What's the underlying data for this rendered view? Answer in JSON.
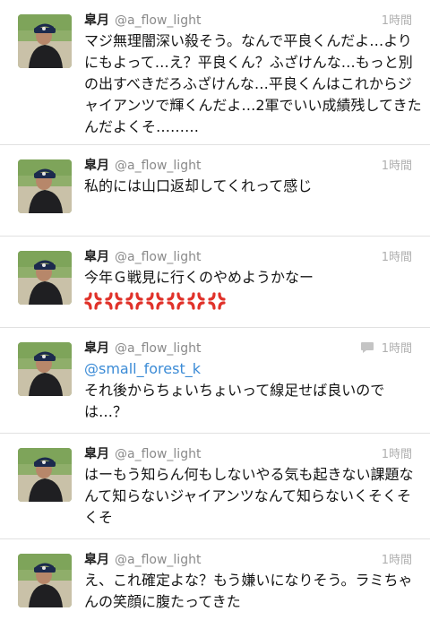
{
  "tweets": [
    {
      "name": "皐月",
      "handle": "@a_flow_light",
      "time": "1時間",
      "text": "マジ無理闇深い殺そう。なんで平良くんだよ…よりにもよって…え？平良くん？ふざけんな…もっと別の出すべきだろふざけんな…平良くんはこれからジャイアンツで輝くんだよ…2軍でいい成績残してきたんだよくそ………"
    },
    {
      "name": "皐月",
      "handle": "@a_flow_light",
      "time": "1時間",
      "text": "私的には山口返却してくれって感じ"
    },
    {
      "name": "皐月",
      "handle": "@a_flow_light",
      "time": "1時間",
      "text": "今年Ｇ戦見に行くのやめようかなー",
      "emoji_count": 7,
      "emoji_name": "anger-symbol-icon"
    },
    {
      "name": "皐月",
      "handle": "@a_flow_light",
      "time": "1時間",
      "has_reply": true,
      "mention": "@small_forest_k",
      "text": "それ後からちょいちょいって線足せば良いのでは…？"
    },
    {
      "name": "皐月",
      "handle": "@a_flow_light",
      "time": "1時間",
      "text": "はーもう知らん何もしないやる気も起きない課題なんて知らないジャイアンツなんて知らないくそくそくそ"
    },
    {
      "name": "皐月",
      "handle": "@a_flow_light",
      "time": "1時間",
      "text": "え、これ確定よな？もう嫌いになりそう。ラミちゃんの笑顔に腹たってきた"
    }
  ],
  "colors": {
    "mention": "#3b8bd6",
    "anger": "#e0322a",
    "time": "#b0b0b0"
  }
}
